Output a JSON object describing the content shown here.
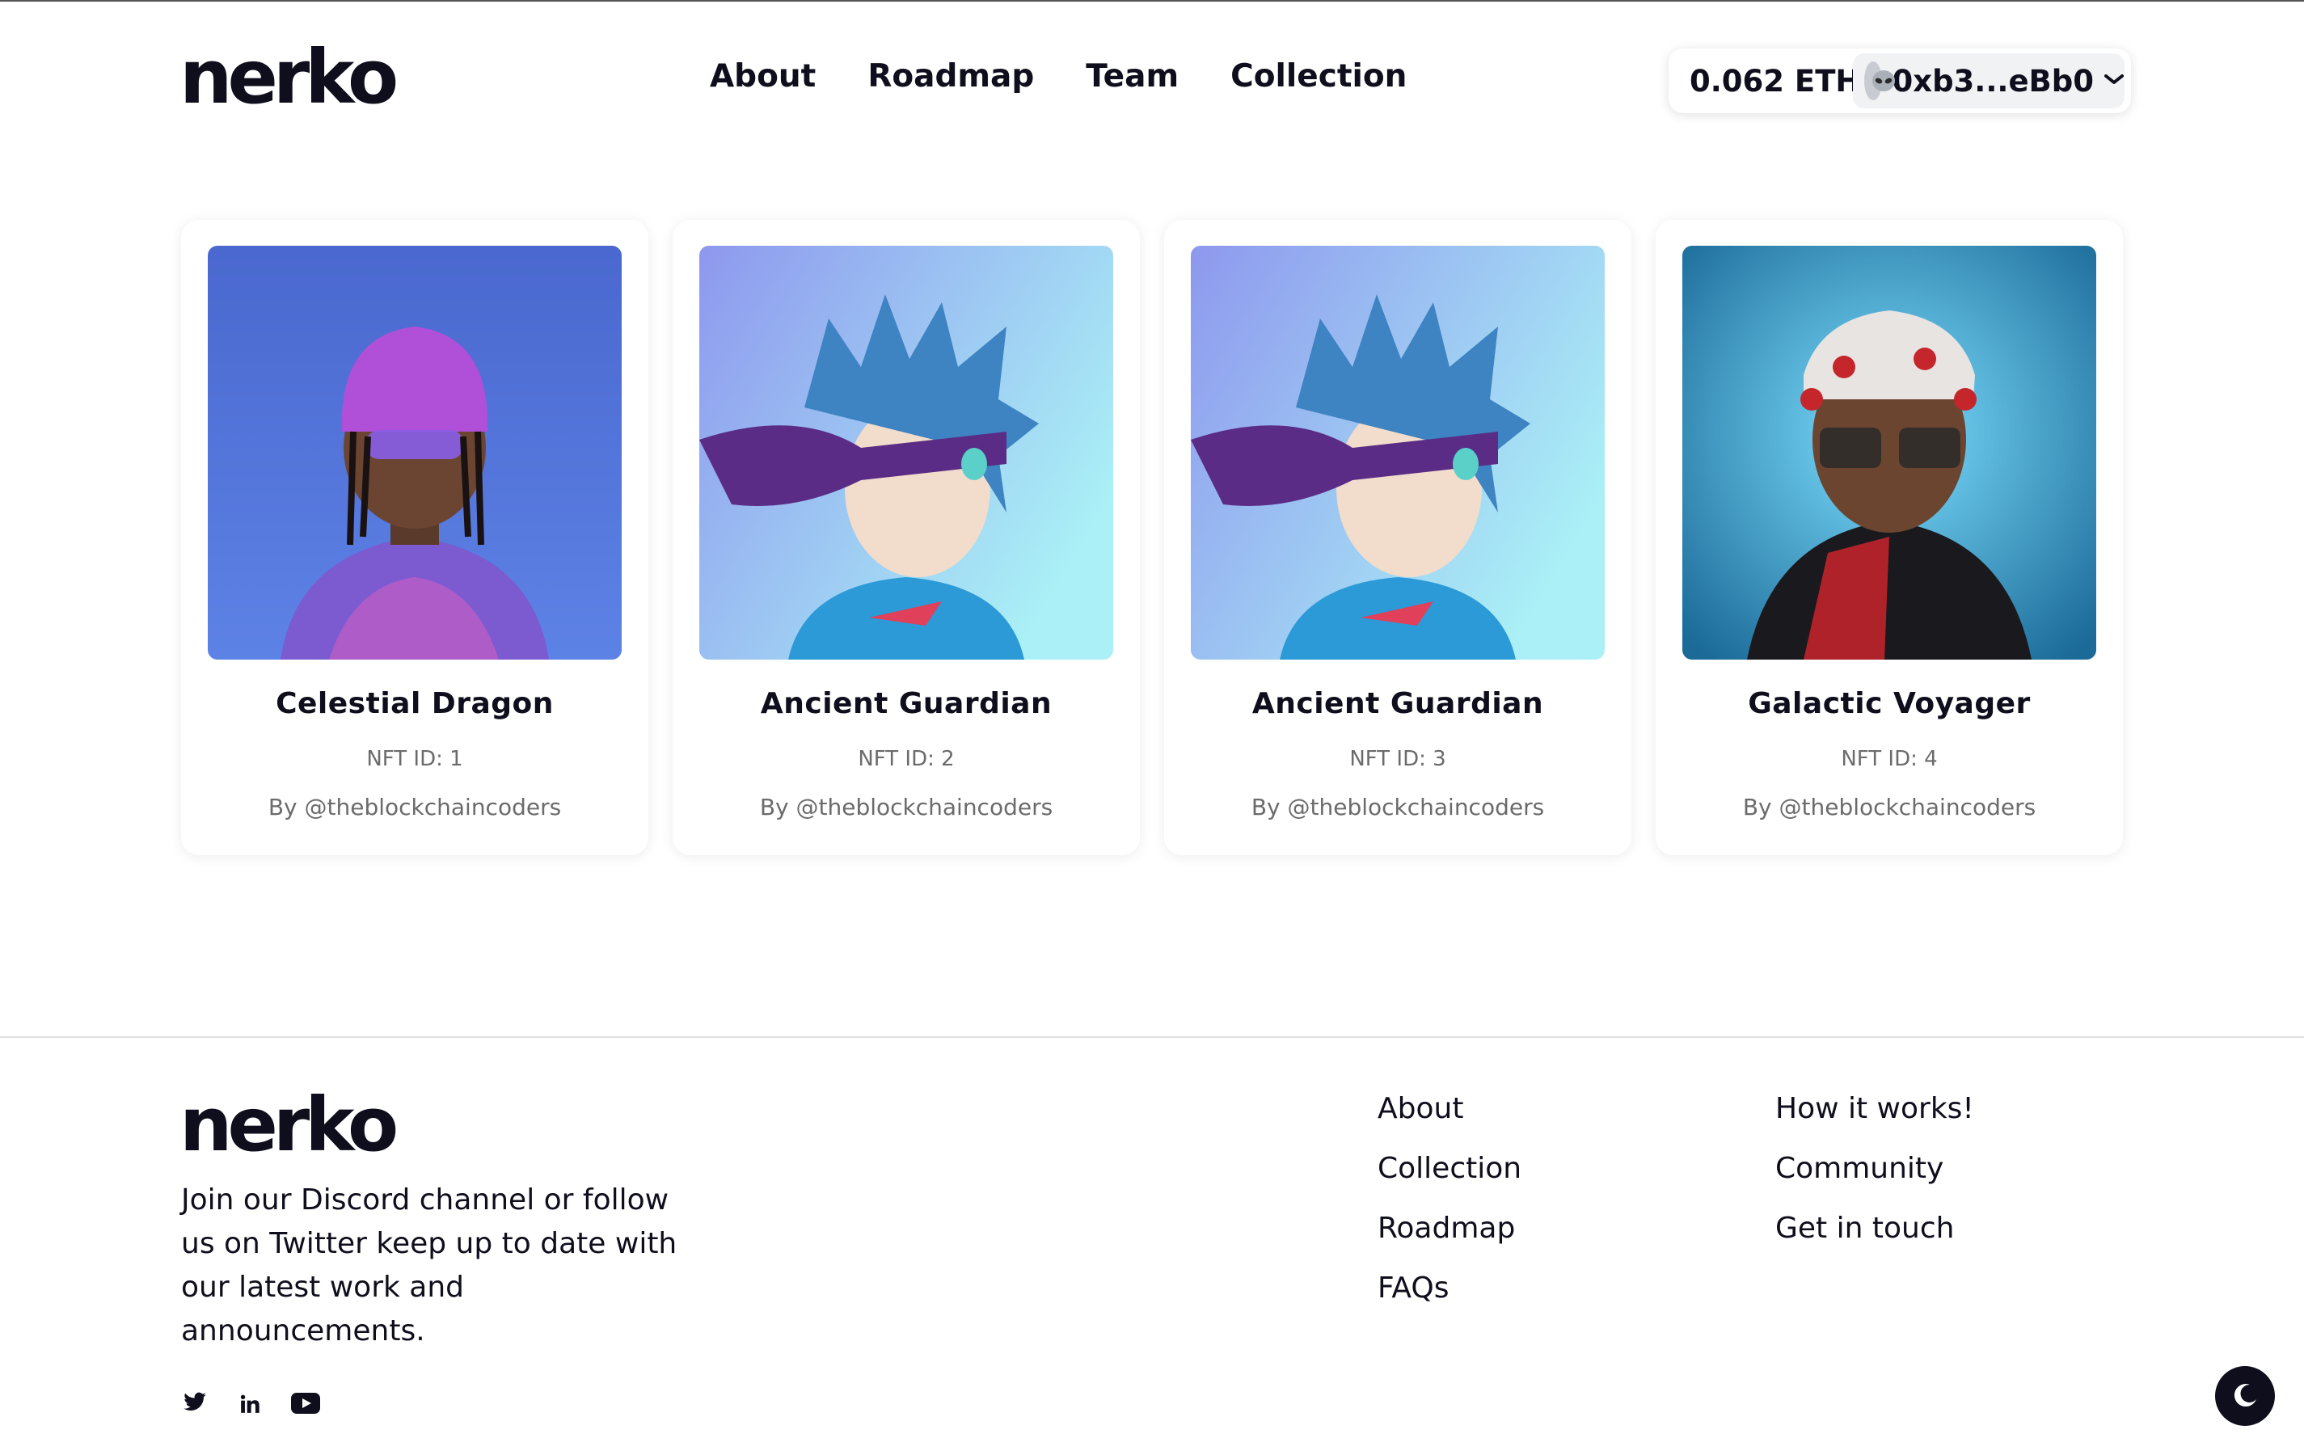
{
  "brand": {
    "logo_text": "nerko"
  },
  "nav": {
    "items": [
      "About",
      "Roadmap",
      "Team",
      "Collection"
    ]
  },
  "wallet": {
    "balance": "0.062 ETH",
    "address": "0xb3...eBb0",
    "avatar_icon": "alien-icon",
    "dropdown_icon": "chevron-down-icon"
  },
  "collection": [
    {
      "name": "Celestial Dragon",
      "nft_id": "NFT ID: 1",
      "by": "By @theblockchaincoders",
      "bg": [
        "#4f6fd4",
        "#5f84e4"
      ],
      "accent": "#b34fd6"
    },
    {
      "name": "Ancient Guardian",
      "nft_id": "NFT ID: 2",
      "by": "By @theblockchaincoders",
      "bg": [
        "#8f9ef0",
        "#a8ecf6"
      ],
      "accent": "#3a8fd0"
    },
    {
      "name": "Ancient Guardian",
      "nft_id": "NFT ID: 3",
      "by": "By @theblockchaincoders",
      "bg": [
        "#8f9ef0",
        "#a8ecf6"
      ],
      "accent": "#3a8fd0"
    },
    {
      "name": "Galactic Voyager",
      "nft_id": "NFT ID: 4",
      "by": "By @theblockchaincoders",
      "bg": [
        "#6fd6ff",
        "#1a6fa0"
      ],
      "accent": "#c4262c"
    }
  ],
  "footer": {
    "logo_text": "nerko",
    "description": "Join our Discord channel or follow us on Twitter keep up to date with our latest work and announcements.",
    "social_icons": [
      "twitter-icon",
      "linkedin-icon",
      "youtube-icon"
    ],
    "col1": [
      "About",
      "Collection",
      "Roadmap",
      "FAQs"
    ],
    "col2": [
      "How it works!",
      "Community",
      "Get in touch"
    ]
  },
  "theme_toggle_icon": "moon-icon"
}
